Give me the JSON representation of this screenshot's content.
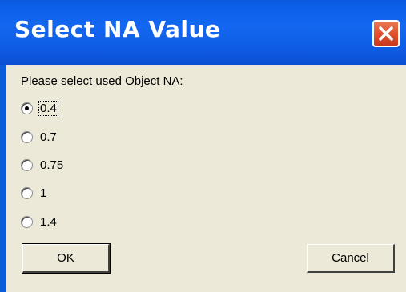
{
  "window": {
    "title": "Select NA Value",
    "close_icon": "close-icon"
  },
  "dialog": {
    "prompt": "Please select used Object NA:",
    "selected_index": 0,
    "options": [
      {
        "label": "0.4"
      },
      {
        "label": "0.7"
      },
      {
        "label": "0.75"
      },
      {
        "label": "1"
      },
      {
        "label": "1.4"
      }
    ],
    "ok_label": "OK",
    "cancel_label": "Cancel"
  },
  "colors": {
    "titlebar": "#0b5fe8",
    "close_button": "#e0512d",
    "dialog_background": "#ece9d8"
  }
}
